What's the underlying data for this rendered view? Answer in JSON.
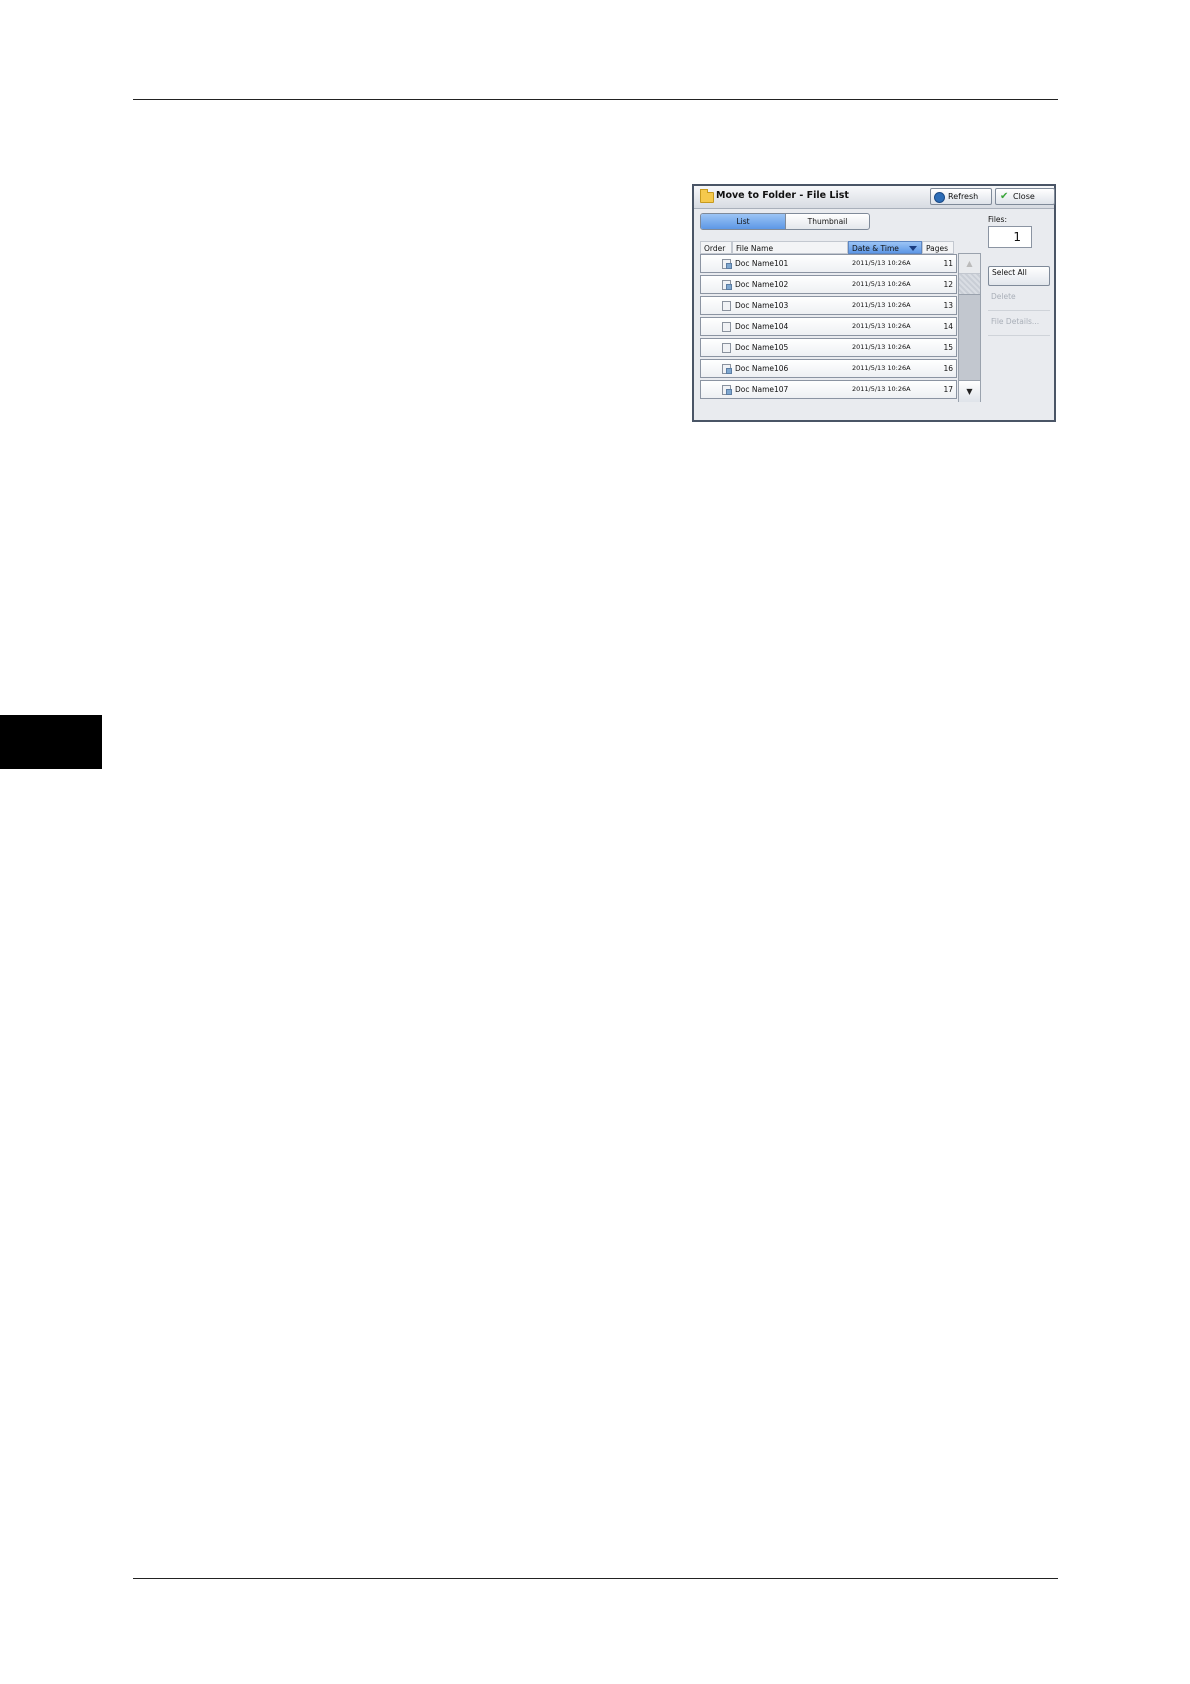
{
  "dialog": {
    "title": "Move to Folder - File List",
    "refresh_label": "Refresh",
    "close_label": "Close",
    "tabs": {
      "list": "List",
      "thumbnail": "Thumbnail"
    },
    "files_label": "Files:",
    "files_count": "1",
    "columns": {
      "order": "Order",
      "file_name": "File Name",
      "date_time": "Date & Time",
      "pages": "Pages"
    },
    "rows": [
      {
        "name": "Doc Name101",
        "date": "2011/5/13 10:26A",
        "pages": "11"
      },
      {
        "name": "Doc Name102",
        "date": "2011/5/13 10:26A",
        "pages": "12"
      },
      {
        "name": "Doc Name103",
        "date": "2011/5/13 10:26A",
        "pages": "13"
      },
      {
        "name": "Doc Name104",
        "date": "2011/5/13 10:26A",
        "pages": "14"
      },
      {
        "name": "Doc Name105",
        "date": "2011/5/13 10:26A",
        "pages": "15"
      },
      {
        "name": "Doc Name106",
        "date": "2011/5/13 10:26A",
        "pages": "16"
      },
      {
        "name": "Doc Name107",
        "date": "2011/5/13 10:26A",
        "pages": "17"
      }
    ],
    "side_buttons": {
      "select_all": "Select All",
      "delete": "Delete",
      "file_details": "File Details..."
    },
    "icons": {
      "title": "folder-icon",
      "refresh": "refresh-icon",
      "close": "check-icon",
      "scroll_up": "▲",
      "scroll_down": "▼"
    }
  }
}
